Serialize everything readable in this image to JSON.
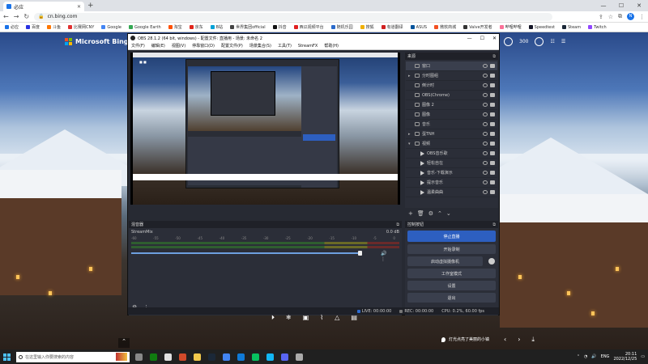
{
  "browser": {
    "tab_title": "必应",
    "url": "cn.bing.com",
    "profile_initial": "N",
    "bookmarks": [
      {
        "label": "必应",
        "color": "#1a73e8"
      },
      {
        "label": "百度",
        "color": "#2932e1"
      },
      {
        "label": "斗鱼",
        "color": "#ff7700"
      },
      {
        "label": "比赛网CNY",
        "color": "#e03030"
      },
      {
        "label": "Google",
        "color": "#4285f4"
      },
      {
        "label": "Google Earth",
        "color": "#34a853"
      },
      {
        "label": "淘宝",
        "color": "#ff5000"
      },
      {
        "label": "京东",
        "color": "#e1251b"
      },
      {
        "label": "B站",
        "color": "#00a1d6"
      },
      {
        "label": "世界集团official",
        "color": "#444444"
      },
      {
        "label": "抖音",
        "color": "#111111"
      },
      {
        "label": "西瓜视频平台",
        "color": "#e02020"
      },
      {
        "label": "随机乐园",
        "color": "#2a6acb"
      },
      {
        "label": "搜狐",
        "color": "#f0b000"
      },
      {
        "label": "有道翻译",
        "color": "#d02020"
      },
      {
        "label": "ASUS",
        "color": "#00539b"
      },
      {
        "label": "微软商城",
        "color": "#f25022"
      },
      {
        "label": "Valve开发者",
        "color": "#333333"
      },
      {
        "label": "哔哩哔哩",
        "color": "#fb7299"
      },
      {
        "label": "Speedtest",
        "color": "#141526"
      },
      {
        "label": "Steam",
        "color": "#1b2838"
      },
      {
        "label": "Twitch",
        "color": "#9146ff"
      }
    ]
  },
  "bing": {
    "logo_text": "Microsoft Bing",
    "points": "300",
    "caption": "灯光点亮了美丽的小镇"
  },
  "obs": {
    "title": "OBS 28.1.2 (64 bit, windows) - 配置文件: 直播用 - 场景: 未命名 2",
    "menu": [
      "文件(F)",
      "编辑(E)",
      "视图(V)",
      "停靠窗口(D)",
      "配置文件(P)",
      "场景集合(S)",
      "工具(T)",
      "StreamFX",
      "帮助(H)"
    ],
    "sources_title": "来源",
    "sources": [
      {
        "name": "窗口",
        "chevron": "",
        "selected": true,
        "child": false,
        "icon": "box"
      },
      {
        "name": "分时图组",
        "chevron": "▸",
        "selected": false,
        "child": false,
        "icon": "box"
      },
      {
        "name": "倒计时",
        "chevron": "",
        "selected": false,
        "child": false,
        "icon": "box"
      },
      {
        "name": "OBS(Chrome)",
        "chevron": "",
        "selected": false,
        "child": false,
        "icon": "box"
      },
      {
        "name": "图像 2",
        "chevron": "",
        "selected": false,
        "child": false,
        "icon": "box"
      },
      {
        "name": "图像",
        "chevron": "",
        "selected": false,
        "child": false,
        "icon": "box"
      },
      {
        "name": "音乐",
        "chevron": "",
        "selected": false,
        "child": false,
        "icon": "box"
      },
      {
        "name": "蛋TNH",
        "chevron": "▸",
        "selected": false,
        "child": false,
        "icon": "box"
      },
      {
        "name": "视频",
        "chevron": "▾",
        "selected": false,
        "child": false,
        "icon": "box"
      },
      {
        "name": "OBS音乐歌",
        "chevron": "",
        "selected": false,
        "child": true,
        "icon": "play"
      },
      {
        "name": "轻松自在",
        "chevron": "",
        "selected": false,
        "child": true,
        "icon": "play"
      },
      {
        "name": "音乐-下载演示",
        "chevron": "",
        "selected": false,
        "child": true,
        "icon": "play"
      },
      {
        "name": "提示音乐",
        "chevron": "",
        "selected": false,
        "child": true,
        "icon": "play"
      },
      {
        "name": "温柔曲曲",
        "chevron": "",
        "selected": false,
        "child": true,
        "icon": "play"
      }
    ],
    "mixer_title": "混音器",
    "mixer": {
      "channel": "StreamMix",
      "db": "0.0 dB",
      "scale": [
        "-60",
        "-55",
        "-50",
        "-45",
        "-40",
        "-35",
        "-30",
        "-25",
        "-20",
        "-15",
        "-10",
        "-5",
        "0"
      ],
      "fader_level": 0.94
    },
    "controls_title": "控制按钮",
    "controls": {
      "stop_stream": "停止直播",
      "start_record": "开始录制",
      "virtual_cam": "启动虚拟摄像机",
      "studio_mode": "工作室模式",
      "settings": "设置",
      "exit": "退出"
    },
    "status": {
      "live": "LIVE: 00:00:00",
      "rec": "REC: 00:00:00",
      "cpu": "CPU: 0.2%, 60.00 fps"
    }
  },
  "taskbar": {
    "search_placeholder": "在这里输入你要搜索的内容",
    "lang": "ENG",
    "time": "20:11",
    "date": "2022/12/25",
    "icons": [
      {
        "name": "task-view-icon",
        "color": "#888888"
      },
      {
        "name": "xbox-icon",
        "color": "#107c10"
      },
      {
        "name": "obs-icon",
        "color": "#e0e0e0"
      },
      {
        "name": "davinci-icon",
        "color": "#d04a2a"
      },
      {
        "name": "explorer-icon",
        "color": "#f2c94c"
      },
      {
        "name": "steam-icon",
        "color": "#1b2838"
      },
      {
        "name": "chrome-icon",
        "color": "#4285f4"
      },
      {
        "name": "edge-icon",
        "color": "#0f7ad8"
      },
      {
        "name": "wechat-icon",
        "color": "#07c160"
      },
      {
        "name": "qq-icon",
        "color": "#12b7f5"
      },
      {
        "name": "discord-icon",
        "color": "#5865f2"
      },
      {
        "name": "settings-icon",
        "color": "#aaaaaa"
      }
    ]
  }
}
